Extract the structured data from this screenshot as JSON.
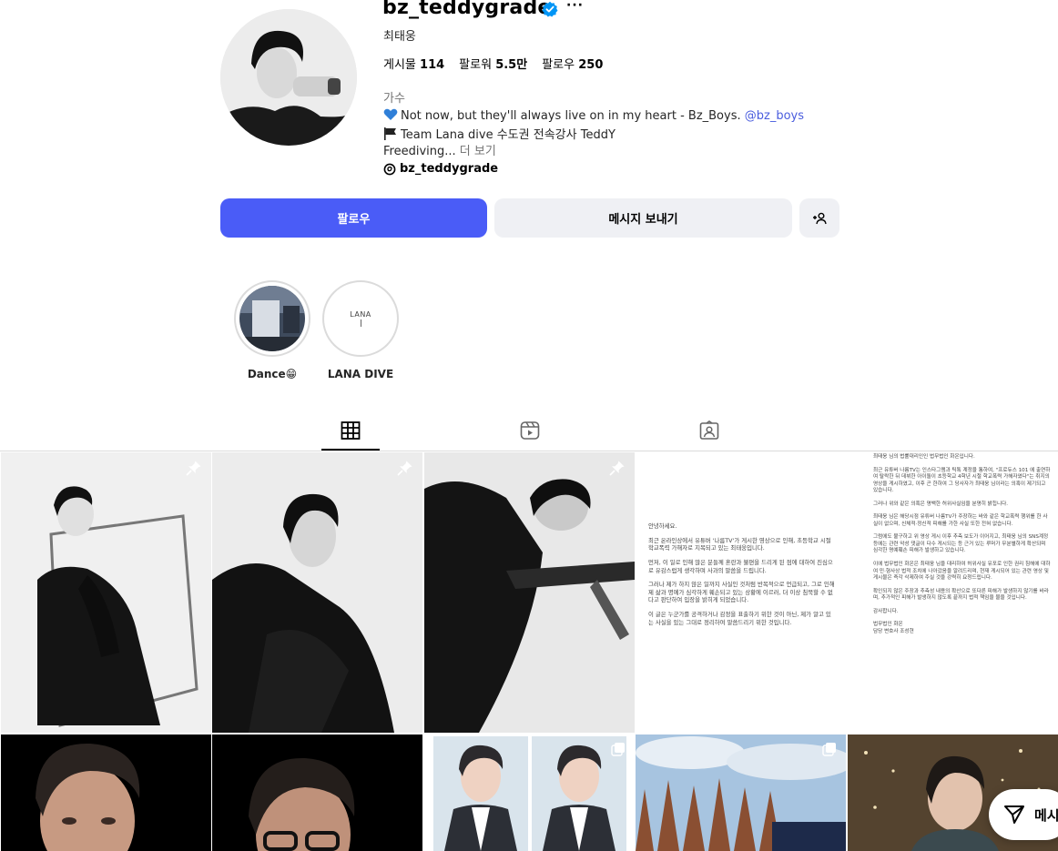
{
  "profile": {
    "username": "bz_teddygrade",
    "full_name": "최태웅",
    "stats": {
      "posts_label": "게시물",
      "posts_value": "114",
      "followers_label": "팔로워",
      "followers_value": "5.5만",
      "following_label": "팔로우",
      "following_value": "250"
    },
    "category": "가수",
    "bio": {
      "line1_text": "Not now, but they'll always live on in my heart - Bz_Boys.",
      "line1_mention": "@bz_boys",
      "line2_text": "Team Lana dive 수도권 전속강사 TeddY",
      "line3_text": "Freediving...",
      "line3_more": "더 보기"
    },
    "threads_handle": "bz_teddygrade"
  },
  "actions": {
    "follow_label": "팔로우",
    "message_label": "메시지 보내기"
  },
  "highlights": [
    {
      "label": "Dance😁"
    },
    {
      "label": "LANA DIVE",
      "logo_text": "LANA"
    }
  ],
  "tabs": [
    "posts-grid",
    "reels",
    "tagged"
  ],
  "documents": {
    "notice_left": [
      "안녕하세요.",
      "최근 온라인상에서 유튜버 '나름TV'가 게시한 영상으로 인해, 초등학교 시절 학교폭력 가해자로 지목되고 있는 최태웅입니다.",
      "먼저, 이 일로 인해 많은 분들께 혼란과 불편을 드리게 된 점에 대하여 진심으로 유감스럽게 생각하며 사과의 말씀을 드립니다.",
      "그러나 제가 하지 않은 일까지 사실인 것처럼 반복적으로 언급되고, 그로 인해 제 삶과 명예가 심각하게 훼손되고 있는 상황에 이르러, 더 이상 침묵할 수 없다고 판단하여 입장을 밝히게 되었습니다.",
      "이 글은 누군가를 공격하거나 감정을 표출하기 위한 것이 아닌, 제가 알고 있는 사실을 있는 그대로 정리하여 말씀드리기 위한 것입니다."
    ],
    "notice_right": [
      "최태웅 님의 법률대리인인 법무법인 화온입니다.",
      "최근 유튜버 나름TV는 인스타그램과 틱톡 계정을 통하여, \"프로듀스 101 에 출연하여 탈락한 뒤 데뷔한 아이돌이 초등학교 4학년 시절 학교폭력 가해자였다\"는 취지의 영상을 게시하였고, 이후 곤 한하여 그 당사자가 최태웅 님이라는 의혹이 제기되고 있습니다.",
      "그러나 위와 같은 의혹은 명백한 허위사실임을 분명히 밝힙니다.",
      "최태웅 님은 해당시점 유튜버 나름TV가 주장하는 바와 같은 학교폭력 행위를 한 사실이 없으며, 신체적·정신적 피해를 가한 사실 또한 전혀 없습니다.",
      "그럼에도 불구하고 위 영상 게시 이후 추측 보도가 이어지고, 최태웅 님의 SNS계정 등에는 관련 악성 댓글이 다수 게시되는 등 근거 있는 루머가 무분별하게 확산되며 심각한 명예훼손 피해가 발생하고 있습니다.",
      "이에 법무법인 화온은 최태웅 님을 대리하여 허위사실 유포로 인한 권리 침해에 대하여 민·형사상 법적 조치에 나아갔음을 알려드리며, 현재 게시되어 있는 관련 영상 및 게시물은 즉각 삭제하여 주실 것을 강력히 요청드립니다.",
      "확인되지 않은 주장과 추측성 내용의 확산으로 또다른 피해가 발생하지 않기를 바라며, 추가적인 피해가 발생하지 않도록 끝까지 법적 책임을 물을 것입니다.",
      "감사합니다.",
      "법무법인 화온",
      "담당 변호사 조성현"
    ]
  },
  "fab": {
    "label": "메시"
  },
  "colors": {
    "accent": "#4a5cf7",
    "mention": "#4a5dde",
    "verified": "#0095f6"
  }
}
